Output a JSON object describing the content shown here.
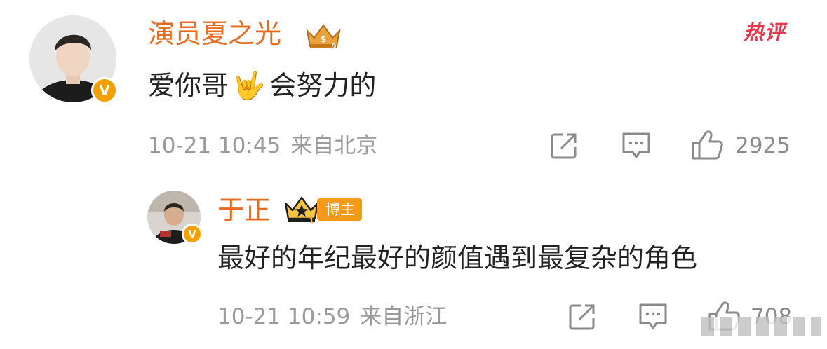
{
  "comment": {
    "username": "演员夏之光",
    "badge_icon": "vip-crown-badge-icon",
    "hot_label": "热评",
    "text_before_emoji": "爱你哥",
    "emoji": "🤟",
    "text_after_emoji": "会努力的",
    "timestamp": "10-21 10:45",
    "location": "来自北京",
    "likes": "2925",
    "verified": true
  },
  "reply": {
    "username": "于正",
    "badge_icon": "crown-badge-icon",
    "blogger_tag": "博主",
    "text": "最好的年纪最好的颜值遇到最复杂的角色",
    "timestamp": "10-21 10:59",
    "location": "来自浙江",
    "likes": "708",
    "verified": true
  },
  "colors": {
    "username": "#e86b1f",
    "hot": "#e8384d",
    "verified": "#f5a000",
    "meta": "#9a9a9a",
    "text": "#222222"
  }
}
